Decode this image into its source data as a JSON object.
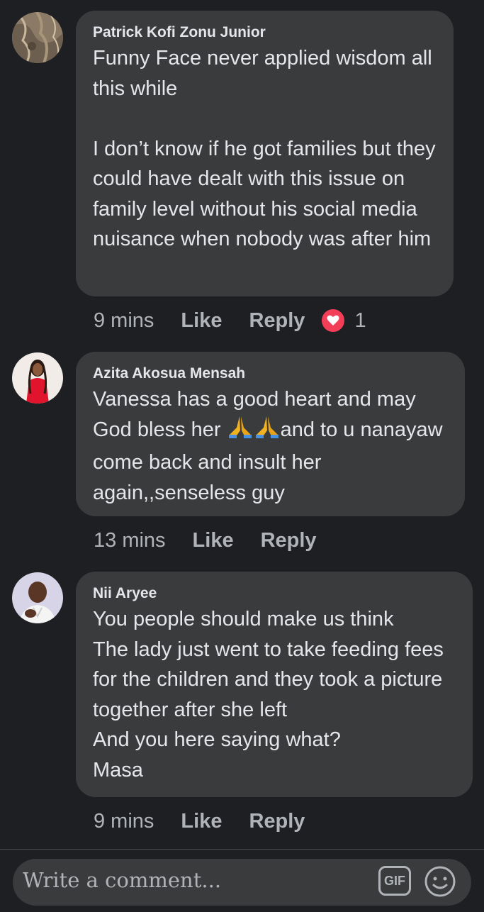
{
  "comments": [
    {
      "author": "Patrick Kofi Zonu Junior",
      "text": "Funny Face never applied wisdom all this while\n\nI don’t know if he got families but they could have dealt with this issue on family level without his social media nuisance when nobody was after him",
      "time": "9 mins",
      "like_label": "Like",
      "reply_label": "Reply",
      "reaction_icon": "heart-icon",
      "reaction_count": "1"
    },
    {
      "author": "Azita Akosua Mensah",
      "text_part1": "Vanessa has a good heart and may God bless her ",
      "emoji": "🙏🙏",
      "text_part2": "and to u nanayaw come back and insult her again,,senseless guy",
      "time": "13 mins",
      "like_label": "Like",
      "reply_label": "Reply"
    },
    {
      "author": "Nii Aryee",
      "text": "You people should make us think\nThe lady just went to take feeding fees for the children and they took a picture together after she left\nAnd you here saying what?\nMasa",
      "time": "9 mins",
      "like_label": "Like",
      "reply_label": "Reply"
    }
  ],
  "composer": {
    "placeholder": "Write a comment...",
    "gif_label": "GIF",
    "emoji_icon": "smiley-icon"
  },
  "colors": {
    "background": "#1e1f22",
    "bubble": "#3a3b3c",
    "text": "#e4e6eb",
    "secondary": "#b0b3b8",
    "heart": "#f33e58"
  }
}
